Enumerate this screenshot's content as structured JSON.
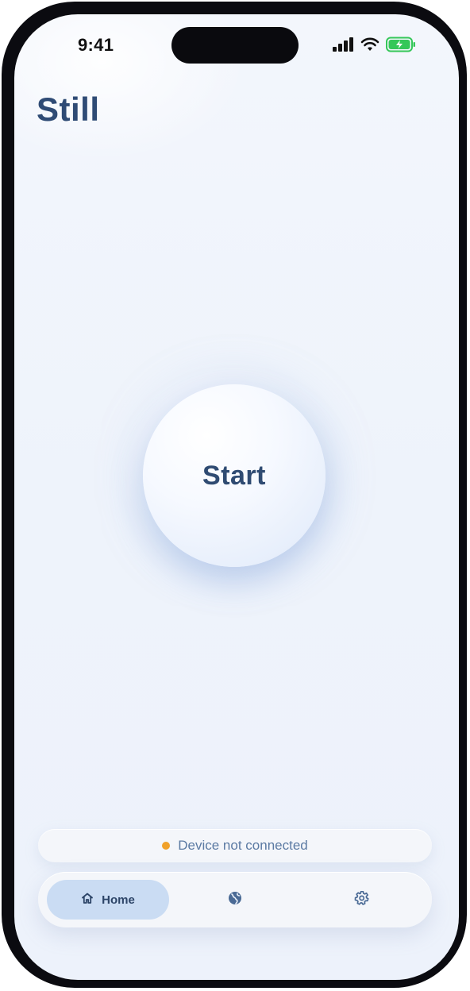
{
  "status_bar": {
    "time": "9:41",
    "icons": [
      "signal-icon",
      "wifi-icon",
      "battery-charging-icon"
    ]
  },
  "app": {
    "title": "Still"
  },
  "main": {
    "start_label": "Start"
  },
  "device": {
    "status_text": "Device not connected",
    "status_color": "#f0a12a"
  },
  "tab_bar": {
    "tabs": [
      {
        "label": "Home",
        "icon": "home-icon",
        "selected": true
      },
      {
        "label": "",
        "icon": "globe-icon",
        "selected": false
      },
      {
        "label": "",
        "icon": "gear-icon",
        "selected": false
      }
    ]
  },
  "colors": {
    "accent": "#2f4b75",
    "selected_tab_bg": "#cadcf3",
    "battery_green": "#35c759"
  }
}
